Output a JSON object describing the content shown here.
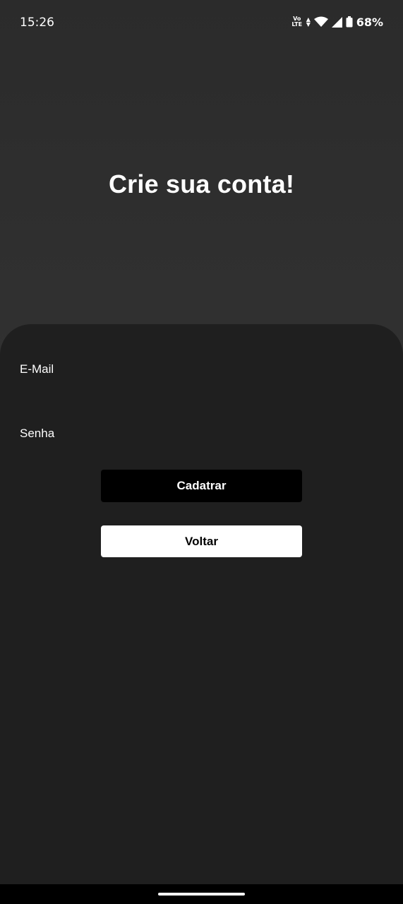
{
  "status_bar": {
    "time": "15:26",
    "volte_top": "Vo",
    "volte_bottom": "LTE",
    "battery_percent": "68%"
  },
  "title": "Crie sua conta!",
  "form": {
    "email_label": "E-Mail",
    "email_value": "",
    "password_label": "Senha",
    "password_value": ""
  },
  "buttons": {
    "register_label": "Cadatrar",
    "back_label": "Voltar"
  },
  "colors": {
    "card_background": "#1f1f1f",
    "register_button": "#000000",
    "back_button": "#ffffff"
  }
}
